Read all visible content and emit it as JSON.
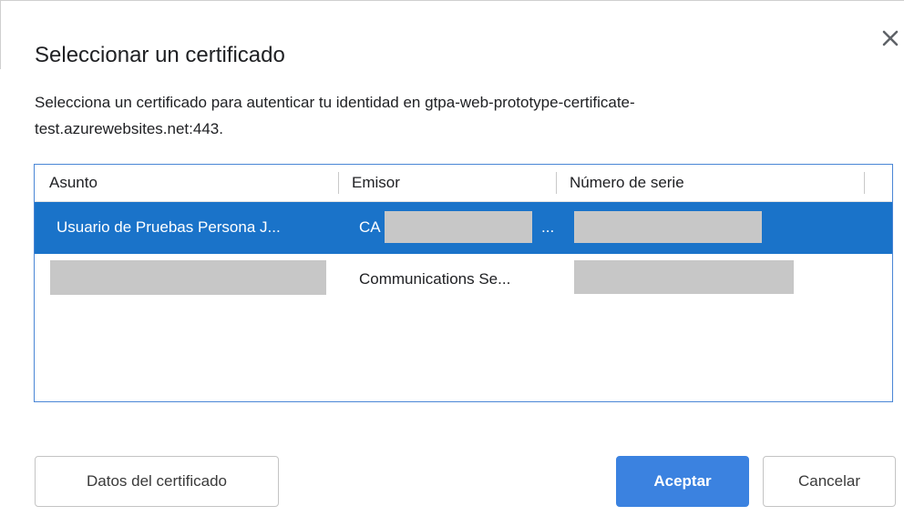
{
  "dialog": {
    "title": "Seleccionar un certificado",
    "description_line1": "Selecciona un certificado para autenticar tu identidad en gtpa-web-prototype-certificate-",
    "description_line2": "test.azurewebsites.net:443.",
    "close_icon": "close-icon"
  },
  "table": {
    "columns": [
      "Asunto",
      "Emisor",
      "Número de serie"
    ],
    "rows": [
      {
        "subject": "Usuario de Pruebas Persona J...",
        "issuer_prefix": "CA",
        "issuer_suffix": "...",
        "serial": "",
        "selected": true
      },
      {
        "subject": "",
        "issuer_prefix": "Communications Se...",
        "issuer_suffix": "",
        "serial": "",
        "selected": false
      }
    ]
  },
  "buttons": {
    "details": "Datos del certificado",
    "accept": "Aceptar",
    "cancel": "Cancelar"
  },
  "colors": {
    "selected_row": "#1a73c9",
    "primary_button": "#3b82e0",
    "table_border": "#4a86d6",
    "redaction": "#c7c7c7"
  }
}
